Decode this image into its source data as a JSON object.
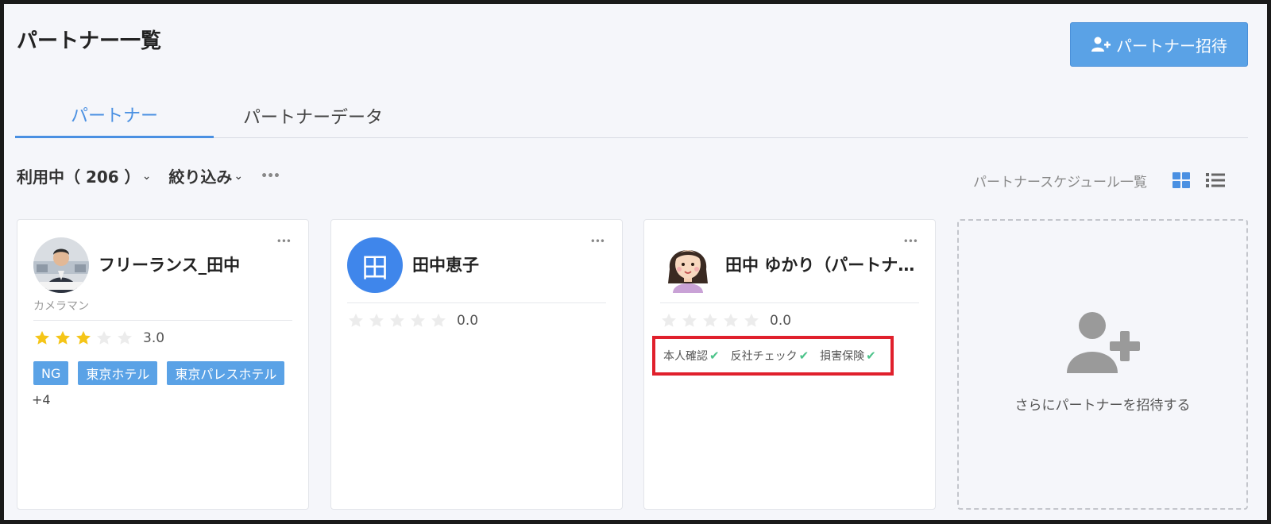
{
  "page": {
    "title": "パートナー一覧"
  },
  "header": {
    "invite_button_label": "パートナー招待"
  },
  "tabs": [
    {
      "label": "パートナー",
      "active": true
    },
    {
      "label": "パートナーデータ",
      "active": false
    }
  ],
  "toolbar": {
    "status_filter": "利用中（ 206 ）",
    "filter_label": "絞り込み",
    "schedule_link": "パートナースケジュール一覧",
    "view_mode": "grid"
  },
  "partners": [
    {
      "name": "フリーランス_田中",
      "role": "カメラマン",
      "avatar": "photo",
      "rating": 3,
      "rating_text": "3.0",
      "tags": [
        "NG",
        "東京ホテル",
        "東京パレスホテル"
      ],
      "more_tags": "+4"
    },
    {
      "name": "田中恵子",
      "avatar": "initial",
      "avatar_initial": "田",
      "avatar_color": "#3f86eb",
      "rating": 0,
      "rating_text": "0.0"
    },
    {
      "name": "田中 ゆかり（パートナー）",
      "avatar": "illustration",
      "rating": 0,
      "rating_text": "0.0",
      "checks": [
        "本人確認",
        "反社チェック",
        "損害保険"
      ]
    }
  ],
  "invite_card": {
    "text": "さらにパートナーを招待する"
  },
  "colors": {
    "accent": "#4a90e2",
    "button": "#5aa2e6",
    "star_filled": "#f5c518",
    "star_empty": "#e8e8e8",
    "check": "#4cc38a",
    "highlight": "#e0202c"
  }
}
